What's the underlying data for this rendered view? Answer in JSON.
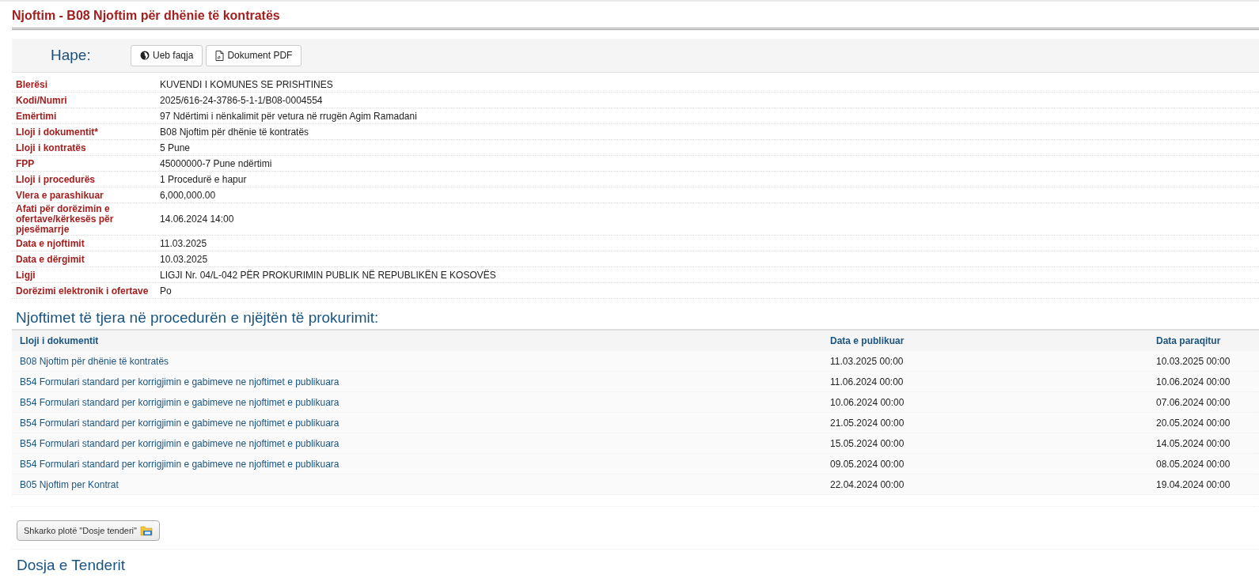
{
  "title": "Njoftim - B08 Njoftim për dhënie të kontratës",
  "open_bar": {
    "label": "Hape:",
    "buttons": [
      {
        "label": "Ueb faqja",
        "kind": "web"
      },
      {
        "label": "Dokument PDF",
        "kind": "pdf"
      }
    ]
  },
  "details": [
    {
      "label": "Blerësi",
      "value": "KUVENDI I KOMUNES SE PRISHTINES"
    },
    {
      "label": "Kodi/Numri",
      "value": "2025/616-24-3786-5-1-1/B08-0004554"
    },
    {
      "label": "Emërtimi",
      "value": "97 Ndërtimi i nënkalimit për vetura në rrugën Agim Ramadani"
    },
    {
      "label": "Lloji i dokumentit*",
      "value": "B08 Njoftim për dhënie të kontratës"
    },
    {
      "label": "Lloji i kontratës",
      "value": "5 Pune"
    },
    {
      "label": "FPP",
      "value": "45000000-7 Pune ndërtimi"
    },
    {
      "label": "Lloji i procedurës",
      "value": "1 Procedurë e hapur"
    },
    {
      "label": "Vlera e parashikuar",
      "value": "6,000,000.00"
    },
    {
      "label": "Afati për dorëzimin e ofertave/kërkesës për pjesëmarrje",
      "value": "14.06.2024 14:00"
    },
    {
      "label": "Data e njoftimit",
      "value": "11.03.2025"
    },
    {
      "label": "Data e dërgimit",
      "value": "10.03.2025"
    },
    {
      "label": "Ligji",
      "value": "LIGJI Nr. 04/L-042 PËR PROKURIMIN PUBLIK NË REPUBLIKËN E KOSOVËS"
    },
    {
      "label": "Dorëzimi elektronik i ofertave",
      "value": "Po"
    }
  ],
  "other_notices": {
    "heading": "Njoftimet të tjera në procedurën e njëjtën të prokurimit:",
    "columns": [
      "Lloji i dokumentit",
      "Data e publikuar",
      "Data paraqitur"
    ],
    "rows": [
      [
        "B08 Njoftim për dhënie të kontratës",
        "11.03.2025 00:00",
        "10.03.2025 00:00"
      ],
      [
        "B54 Formulari standard per korrigjimin e gabimeve ne njoftimet e publikuara",
        "11.06.2024 00:00",
        "10.06.2024 00:00"
      ],
      [
        "B54 Formulari standard per korrigjimin e gabimeve ne njoftimet e publikuara",
        "10.06.2024 00:00",
        "07.06.2024 00:00"
      ],
      [
        "B54 Formulari standard per korrigjimin e gabimeve ne njoftimet e publikuara",
        "21.05.2024 00:00",
        "20.05.2024 00:00"
      ],
      [
        "B54 Formulari standard per korrigjimin e gabimeve ne njoftimet e publikuara",
        "15.05.2024 00:00",
        "14.05.2024 00:00"
      ],
      [
        "B54 Formulari standard per korrigjimin e gabimeve ne njoftimet e publikuara",
        "09.05.2024 00:00",
        "08.05.2024 00:00"
      ],
      [
        "B05 Njoftim per Kontrat",
        "22.04.2024 00:00",
        "19.04.2024 00:00"
      ]
    ]
  },
  "download_button": "Shkarko plotë \"Dosje tenderi\"",
  "tender_heading": "Dosja e Tenderit"
}
